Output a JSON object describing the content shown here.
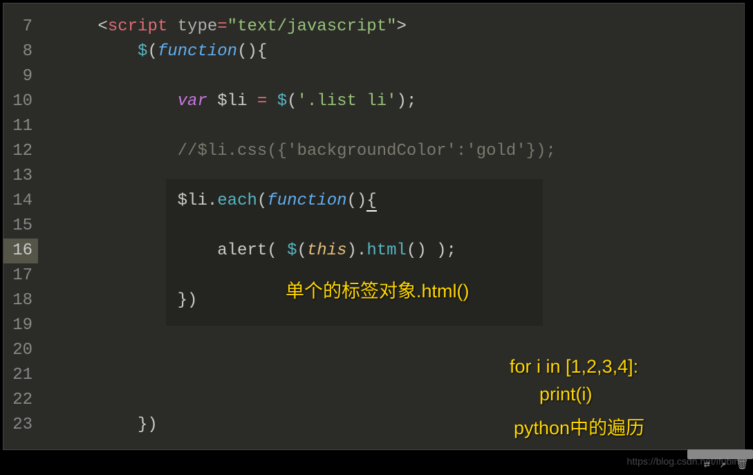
{
  "editor": {
    "line_numbers": [
      "7",
      "8",
      "9",
      "10",
      "11",
      "12",
      "13",
      "14",
      "15",
      "16",
      "17",
      "18",
      "19",
      "20",
      "21",
      "22",
      "23"
    ],
    "highlighted_line_index": 9,
    "code": {
      "l7": {
        "open": "<",
        "tag": "script",
        "sp": " ",
        "attr": "type",
        "eq": "=",
        "str": "\"text/javascript\"",
        "close": ">"
      },
      "l8": {
        "jq": "$",
        "p1": "(",
        "fn": "function",
        "p2": "(){"
      },
      "l10": {
        "kw": "var",
        "sp": " ",
        "var": "$li",
        "sp2": " ",
        "eq": "=",
        "sp3": " ",
        "jq": "$",
        "p1": "(",
        "str": "'.list li'",
        "p2": ");"
      },
      "l12": {
        "comment": "//$li.css({'backgroundColor':'gold'});"
      },
      "l14": {
        "var": "$li",
        "dot": ".",
        "method": "each",
        "p1": "(",
        "fn": "function",
        "p2": "()",
        "brace": "{"
      },
      "l16": {
        "call": "alert",
        "p1": "( ",
        "jq": "$",
        "p2": "(",
        "this": "this",
        "p3": ").",
        "method": "html",
        "p4": "() );"
      },
      "l18": {
        "close": "})"
      },
      "l23": {
        "close": "})"
      }
    }
  },
  "annotations": {
    "html_note": "单个的标签对象.html()",
    "python_line1": "for i in [1,2,3,4]:",
    "python_line2": "print(i)",
    "python_line3": "python中的遍历"
  },
  "watermark": "https://blog.csdn.net/ifubing",
  "icons": {
    "shuffle": "⇄",
    "share": "↗",
    "delete": "🗑"
  }
}
